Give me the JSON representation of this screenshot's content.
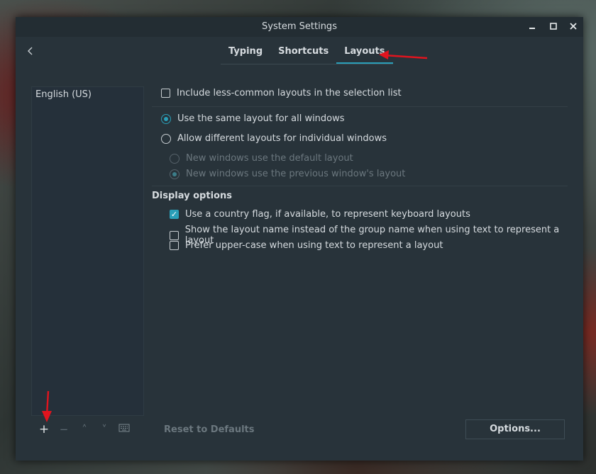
{
  "window": {
    "title": "System Settings",
    "minimize_icon": "minimize-icon",
    "maximize_icon": "maximize-icon",
    "close_icon": "close-icon"
  },
  "nav": {
    "back_icon": "chevron-left-icon",
    "tabs": [
      {
        "label": "Typing",
        "active": false
      },
      {
        "label": "Shortcuts",
        "active": false
      },
      {
        "label": "Layouts",
        "active": true
      }
    ]
  },
  "layouts_list": {
    "items": [
      "English (US)"
    ],
    "buttons": {
      "add": "+",
      "remove": "−",
      "up": "˄",
      "down": "˅",
      "keyboard_icon": "keyboard-icon"
    }
  },
  "settings": {
    "include_less_common": {
      "label": "Include less-common layouts in the selection list",
      "checked": false
    },
    "same_layout": {
      "label": "Use the same layout for all windows",
      "selected": true
    },
    "different_layouts": {
      "label": "Allow different layouts for individual windows",
      "selected": false
    },
    "new_default": {
      "label": "New windows use the default layout",
      "selected": false,
      "enabled": false
    },
    "new_previous": {
      "label": "New windows use the previous window's layout",
      "selected": true,
      "enabled": false
    },
    "display_options_title": "Display options",
    "country_flag": {
      "label": "Use a country flag, if available,  to represent keyboard layouts",
      "checked": true
    },
    "layout_name": {
      "label": "Show the layout name instead of the group name when using text to represent a layout",
      "checked": false
    },
    "upper_case": {
      "label": "Prefer upper-case when using text to represent a layout",
      "checked": false
    }
  },
  "footer": {
    "reset_label": "Reset to Defaults",
    "options_label": "Options..."
  },
  "colors": {
    "accent": "#2a9fb8",
    "window_bg": "#28333a",
    "annotation": "#e0141e"
  }
}
